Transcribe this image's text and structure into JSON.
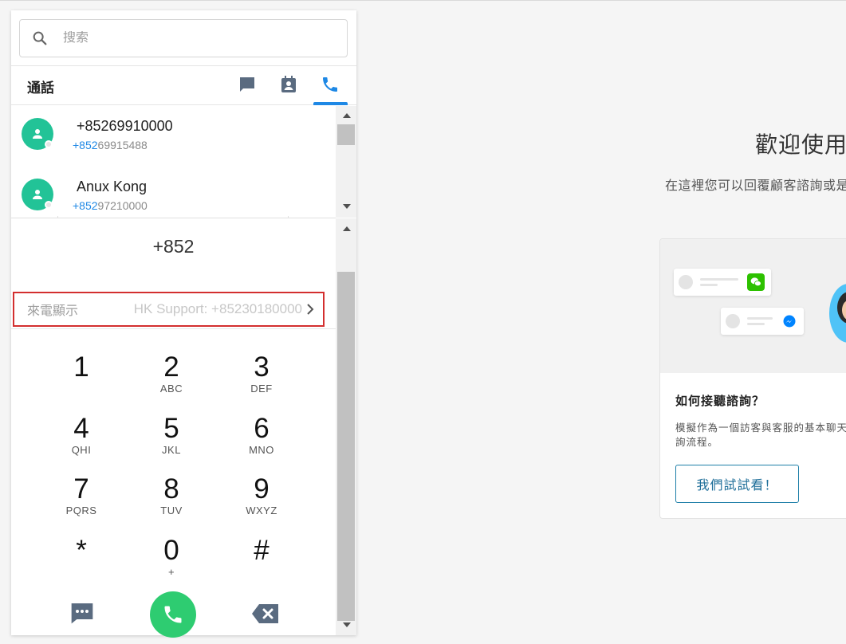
{
  "search": {
    "placeholder": "搜索"
  },
  "header": {
    "title": "通話"
  },
  "tab_icons": [
    "chat-icon",
    "contacts-icon",
    "phone-icon"
  ],
  "contacts": [
    {
      "name": "+85269910000",
      "country_code": "+852",
      "number": "69915488"
    },
    {
      "name": "Anux Kong",
      "country_code": "+852",
      "number": "97210000"
    }
  ],
  "dialer": {
    "number": "+852",
    "caller_id_label": "來電顯示",
    "caller_id_value": "HK Support: +85230180000",
    "keys": [
      {
        "digit": "1",
        "letters": ""
      },
      {
        "digit": "2",
        "letters": "ABC"
      },
      {
        "digit": "3",
        "letters": "DEF"
      },
      {
        "digit": "4",
        "letters": "QHI"
      },
      {
        "digit": "5",
        "letters": "JKL"
      },
      {
        "digit": "6",
        "letters": "MNO"
      },
      {
        "digit": "7",
        "letters": "PQRS"
      },
      {
        "digit": "8",
        "letters": "TUV"
      },
      {
        "digit": "9",
        "letters": "WXYZ"
      },
      {
        "digit": "*",
        "letters": ""
      },
      {
        "digit": "0",
        "letters": "+"
      },
      {
        "digit": "#",
        "letters": ""
      }
    ]
  },
  "welcome": {
    "title": "歡迎使用",
    "subtitle": "在這裡您可以回覆顧客諮詢或是"
  },
  "card": {
    "title": "如何接聽諮詢？",
    "description": "模擬作為一個訪客與客服的基本聊天諮詢流程。",
    "button": "我們試試看！"
  },
  "colors": {
    "accent": "#1e88e5",
    "avatar": "#22c397",
    "call": "#2ecc71",
    "highlight_border": "#d32f2f"
  }
}
